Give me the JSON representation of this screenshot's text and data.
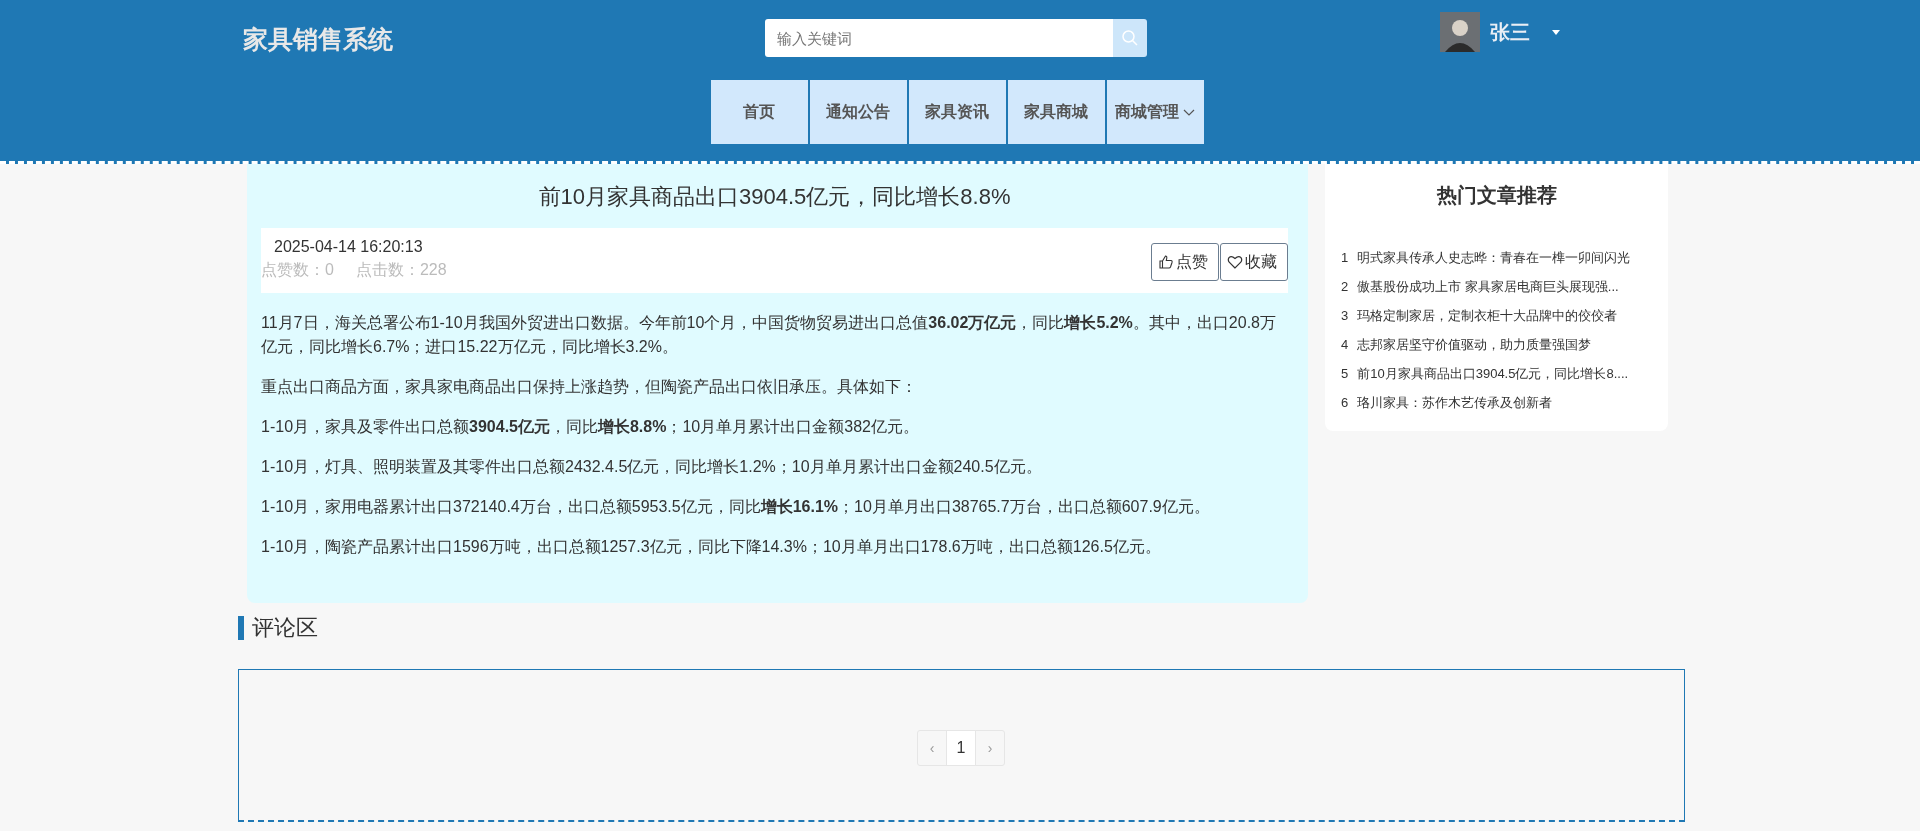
{
  "header": {
    "site_title": "家具销售系统",
    "search": {
      "placeholder": "输入关键词"
    },
    "user": {
      "name": "张三"
    },
    "nav": [
      {
        "label": "首页",
        "dropdown": false
      },
      {
        "label": "通知公告",
        "dropdown": false
      },
      {
        "label": "家具资讯",
        "dropdown": false
      },
      {
        "label": "家具商城",
        "dropdown": false
      },
      {
        "label": "商城管理",
        "dropdown": true
      }
    ]
  },
  "article": {
    "title": "前10月家具商品出口3904.5亿元，同比增长8.8%",
    "date": "2025-04-14 16:20:13",
    "likes": "点赞数：0",
    "clicks": "点击数：228",
    "buttons": [
      {
        "kind": "like",
        "label": "点赞"
      },
      {
        "kind": "favorite",
        "label": "收藏"
      }
    ],
    "paragraphs": [
      "11月7日，海关总署公布1-10月我国外贸进出口数据。今年前10个月，中国货物贸易进出口总值**36.02万亿元**，同比**增长5.2%**。其中，出口20.8万亿元，同比增长6.7%；进口15.22万亿元，同比增长3.2%。",
      "重点出口商品方面，家具家电商品出口保持上涨趋势，但陶瓷产品出口依旧承压。具体如下：",
      "1-10月，家具及零件出口总额**3904.5亿元**，同比**增长8.8%**；10月单月累计出口金额382亿元。",
      "1-10月，灯具、照明装置及其零件出口总额2432.4.5亿元，同比增长1.2%；10月单月累计出口金额240.5亿元。",
      "1-10月，家用电器累计出口372140.4万台，出口总额5953.5亿元，同比**增长16.1%**；10月单月出口38765.7万台，出口总额607.9亿元。",
      "1-10月，陶瓷产品累计出口1596万吨，出口总额1257.3亿元，同比下降14.3%；10月单月出口178.6万吨，出口总额126.5亿元。"
    ]
  },
  "hot_articles": {
    "title": "热门文章推荐",
    "items": [
      {
        "rank": "1",
        "title": "明式家具传承人史志晔：青春在一榫一卯间闪光"
      },
      {
        "rank": "2",
        "title": "傲基股份成功上市 家具家居电商巨头展现强..."
      },
      {
        "rank": "3",
        "title": "玛格定制家居，定制衣柜十大品牌中的佼佼者"
      },
      {
        "rank": "4",
        "title": "志邦家居坚守价值驱动，助力质量强国梦"
      },
      {
        "rank": "5",
        "title": "前10月家具商品出口3904.5亿元，同比增长8...."
      },
      {
        "rank": "6",
        "title": "珞川家具：苏作木艺传承及创新者"
      }
    ]
  },
  "comments": {
    "title": "评论区",
    "pagination": {
      "prev": "‹",
      "next": "›",
      "pages": [
        {
          "label": "1",
          "selected": true
        }
      ]
    }
  }
}
